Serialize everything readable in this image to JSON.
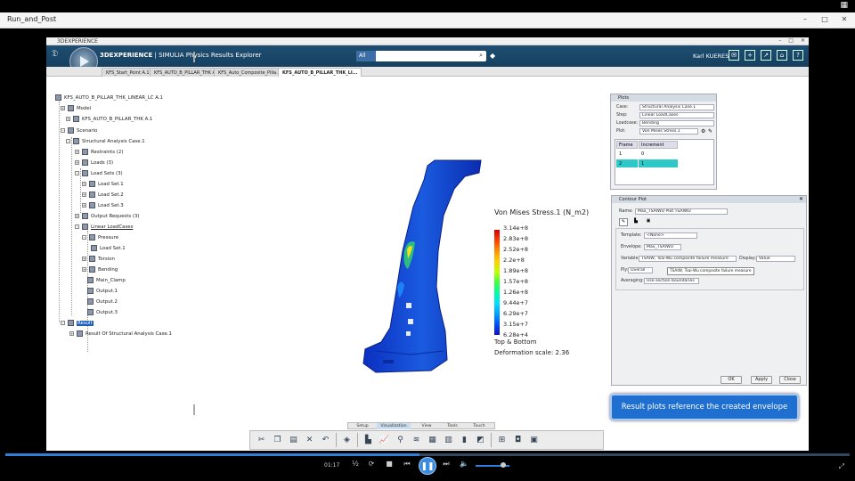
{
  "player": {
    "title": "Run_and_Post",
    "time": "01:17",
    "progress_fraction": 0.49,
    "ctrl_min": "–",
    "ctrl_restore": "□",
    "ctrl_close": "✕"
  },
  "app": {
    "window_title": "3DEXPERIENCE",
    "brand_prefix": "3DEXPERIENCE",
    "brand_suffix": " | SIMULIA Physics Results Explorer",
    "search_scope": "All",
    "search_placeholder": "",
    "user": "Karl KUERES",
    "tabs": [
      {
        "label": "KFS_Start_Point A.1",
        "active": false
      },
      {
        "label": "KFS_AUTO_B_PILLAR_THK A.1",
        "active": false
      },
      {
        "label": "KFS_Auto_Composite_Pilla...",
        "active": false
      },
      {
        "label": "KFS_AUTO_B_PILLAR_THK_LI...",
        "active": true
      }
    ]
  },
  "tree": {
    "root": "KFS_AUTO_B_PILLAR_THK_LINEAR_LC A.1",
    "model": "Model",
    "model_child": "KFS_AUTO_B_PILLAR_THK A.1",
    "scenario": "Scenario",
    "case": "Structural Analysis Case.1",
    "restraints": "Restraints (2)",
    "loads": "Loads (3)",
    "load_sets": "Load Sets (3)",
    "load_set_1": "Load Set.1",
    "load_set_2": "Load Set.2",
    "load_set_3": "Load Set.3",
    "output_requests": "Output Requests (3)",
    "linear_loadcases": "Linear LoadCases",
    "pressure": "Pressure",
    "pressure_child": "Load Set.1",
    "torsion": "Torsion",
    "bending": "Bending",
    "main_clamp": "Main_Clamp",
    "output_1": "Output.1",
    "output_2": "Output.2",
    "output_3": "Output.3",
    "result": "Result",
    "result_child": "Result Of Structural Analysis Case.1"
  },
  "legend": {
    "title": "Von Mises Stress.1 (N_m2)",
    "values": [
      "3.14e+8",
      "2.83e+8",
      "2.52e+8",
      "2.2e+8",
      "1.89e+8",
      "1.57e+8",
      "1.26e+8",
      "9.44e+7",
      "6.29e+7",
      "3.15e+7",
      "6.28e+4"
    ],
    "footer_1": "Top & Bottom",
    "footer_2": "Deformation scale: 2.36"
  },
  "plots_panel": {
    "title": "Plots",
    "case_label": "Case:",
    "case_value": "Structural Analysis Case.1",
    "step_label": "Step:",
    "step_value": "Linear LoadCases",
    "loadcase_label": "Loadcase:",
    "loadcase_value": "Bending",
    "plot_label": "Plot:",
    "plot_value": "Von Mises Stress.1",
    "col_frame": "Frame",
    "col_increment": "Increment",
    "rows": [
      {
        "frame": "1",
        "increment": "0"
      },
      {
        "frame": "2",
        "increment": "1"
      }
    ]
  },
  "contour_panel": {
    "title": "Contour Plot",
    "name_label": "Name:",
    "name_value": "Max_TSAIWU Plot TSAIWU",
    "template_label": "Template:",
    "template_value": "<None>",
    "envelope_label": "Envelope:",
    "envelope_value": "Max_TSAIWU",
    "variable_label": "Variable:",
    "variable_value": "TSAIW, Tsai-Wu composite failure measure",
    "display_label": "Display:",
    "display_value": "Value",
    "ply_label": "Ply:",
    "ply_value": "Overall",
    "averaging_label": "Averaging:",
    "averaging_value": "Use section boundaries",
    "tooltip": "TSAIW, Tsai-Wu composite failure measure",
    "ok": "OK",
    "apply": "Apply",
    "close": "Close"
  },
  "callout": "Result plots reference the created envelope",
  "mode_tabs": [
    "Setup",
    "Visualization",
    "View",
    "Tools",
    "Touch"
  ],
  "active_mode": "Visualization"
}
